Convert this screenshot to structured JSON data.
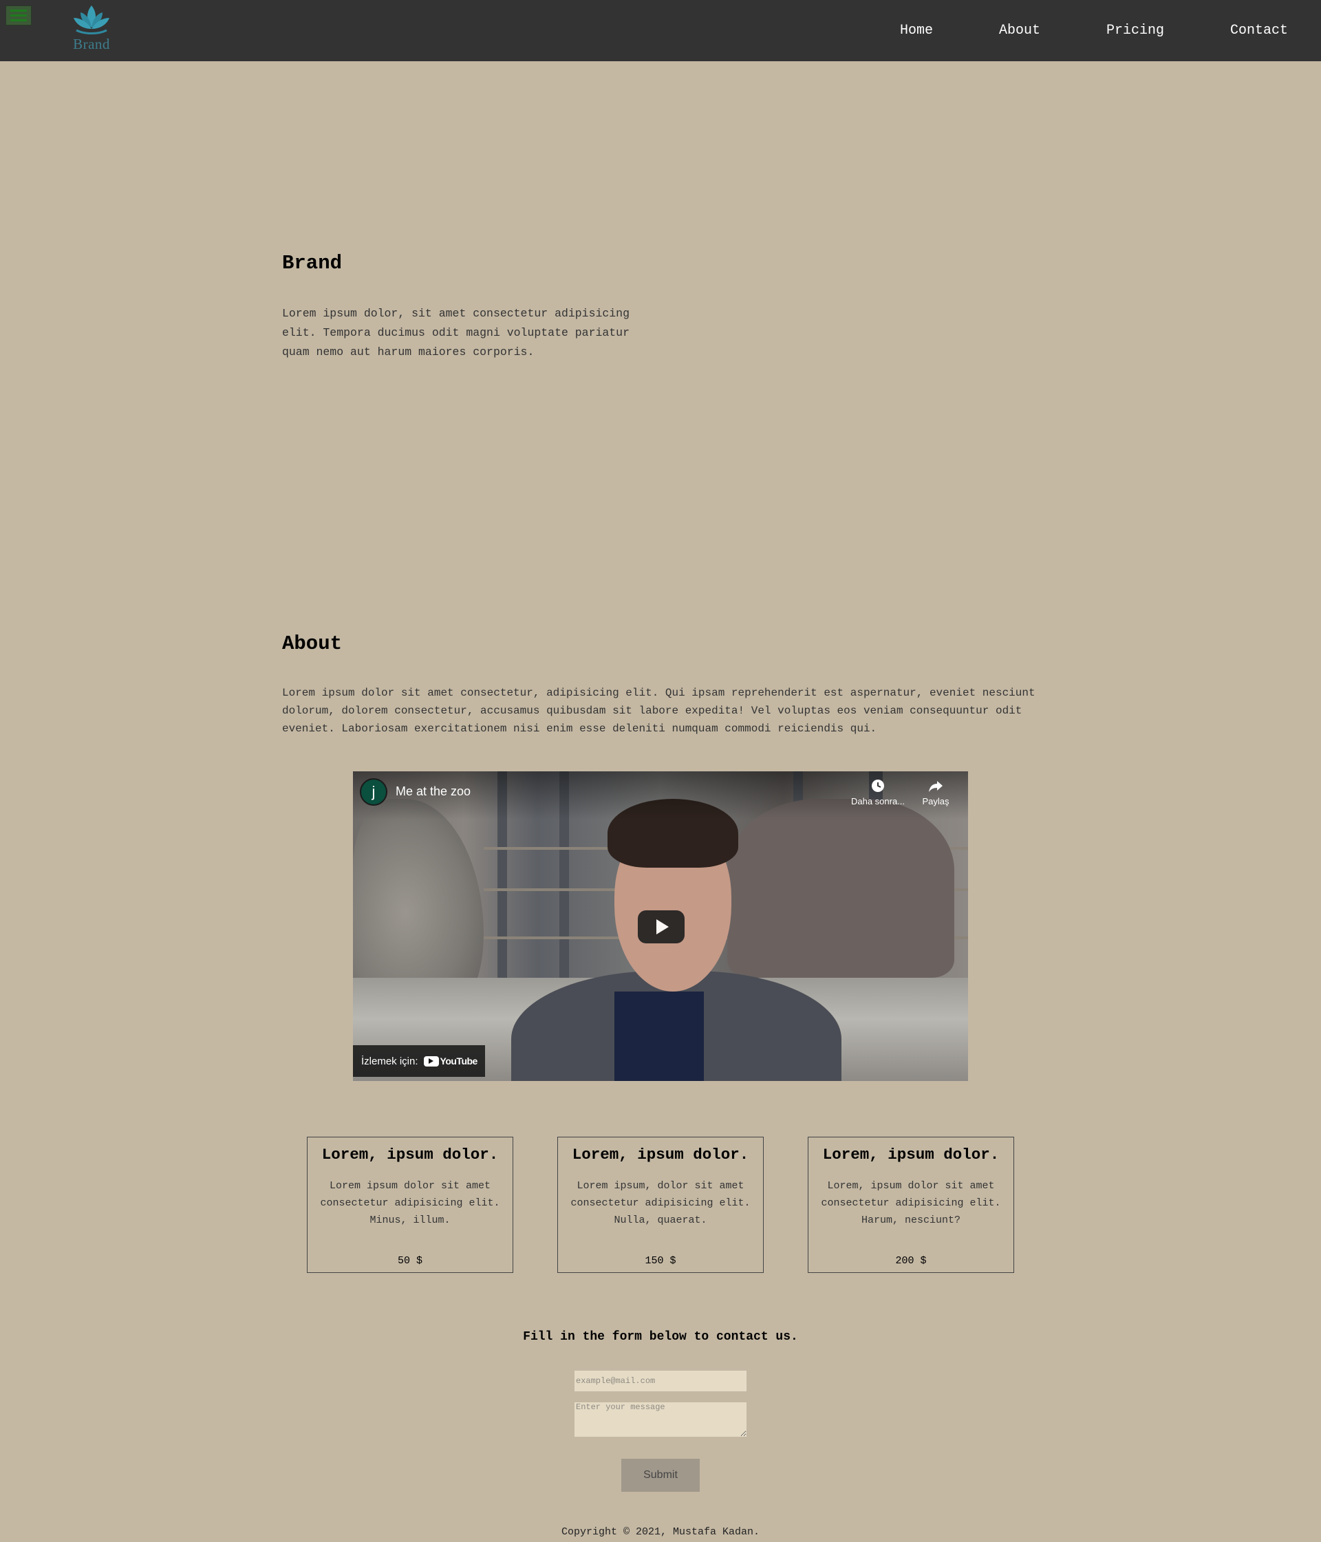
{
  "nav": {
    "brand": "Brand",
    "links": [
      "Home",
      "About",
      "Pricing",
      "Contact"
    ]
  },
  "brand_section": {
    "title": "Brand",
    "text": "Lorem ipsum dolor, sit amet consectetur adipisicing elit. Tempora ducimus odit magni voluptate pariatur quam nemo aut harum maiores corporis."
  },
  "about_section": {
    "title": "About",
    "text": "Lorem ipsum dolor sit amet consectetur, adipisicing elit. Qui ipsam reprehenderit est aspernatur, eveniet nesciunt dolorum, dolorem consectetur, accusamus quibusdam sit labore expedita! Vel voluptas eos veniam consequuntur odit eveniet. Laboriosam exercitationem nisi enim esse deleniti numquam commodi reiciendis qui."
  },
  "video": {
    "channel_initial": "j",
    "title": "Me at the zoo",
    "watch_later": "Daha sonra...",
    "share": "Paylaş",
    "watch_on": "İzlemek için:",
    "platform": "YouTube"
  },
  "pricing": [
    {
      "title": "Lorem, ipsum dolor.",
      "text": "Lorem ipsum dolor sit amet consectetur adipisicing elit. Minus, illum.",
      "price": "50 $"
    },
    {
      "title": "Lorem, ipsum dolor.",
      "text": "Lorem ipsum, dolor sit amet consectetur adipisicing elit. Nulla, quaerat.",
      "price": "150 $"
    },
    {
      "title": "Lorem, ipsum dolor.",
      "text": "Lorem, ipsum dolor sit amet consectetur adipisicing elit. Harum, nesciunt?",
      "price": "200 $"
    }
  ],
  "contact": {
    "heading": "Fill in the form below to contact us.",
    "email_placeholder": "example@mail.com",
    "message_placeholder": "Enter your message",
    "submit_label": "Submit"
  },
  "footer": {
    "copyright": "Copyright © 2021, Mustafa Kadan."
  },
  "colors": {
    "page_bg": "#c4b8a3",
    "nav_bg": "#333333",
    "logo_color": "#3a9fb5",
    "input_bg": "#e6dcc6",
    "button_bg": "#a0988b"
  },
  "icons": [
    "hamburger-menu-icon",
    "lotus-logo-icon",
    "clock-icon",
    "share-arrow-icon",
    "play-icon",
    "youtube-logo-icon"
  ]
}
